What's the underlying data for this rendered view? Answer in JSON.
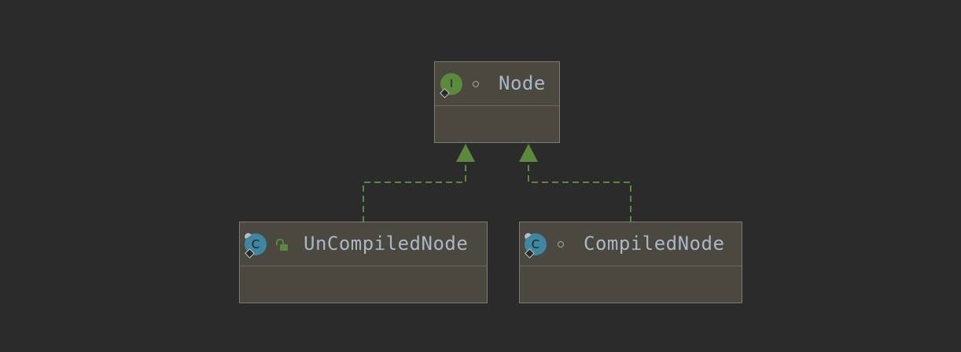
{
  "diagram": {
    "nodes": [
      {
        "id": "node",
        "name": "Node",
        "kind": "interface",
        "kind_letter": "I",
        "visibility": "package-private"
      },
      {
        "id": "uncompiled",
        "name": "UnCompiledNode",
        "kind": "class",
        "kind_letter": "C",
        "visibility": "public"
      },
      {
        "id": "compiled",
        "name": "CompiledNode",
        "kind": "class",
        "kind_letter": "C",
        "visibility": "package-private"
      }
    ],
    "edges": [
      {
        "from": "UnCompiledNode",
        "to": "Node",
        "type": "implements"
      },
      {
        "from": "CompiledNode",
        "to": "Node",
        "type": "implements"
      }
    ]
  },
  "colors": {
    "background": "#2b2b2b",
    "node_fill": "#4b4840",
    "node_border": "#7d7b74",
    "interface_icon": "#5b8a3c",
    "class_icon": "#3e87a3",
    "edge": "#5b8a3c",
    "name_text": "#a9b7c6"
  }
}
